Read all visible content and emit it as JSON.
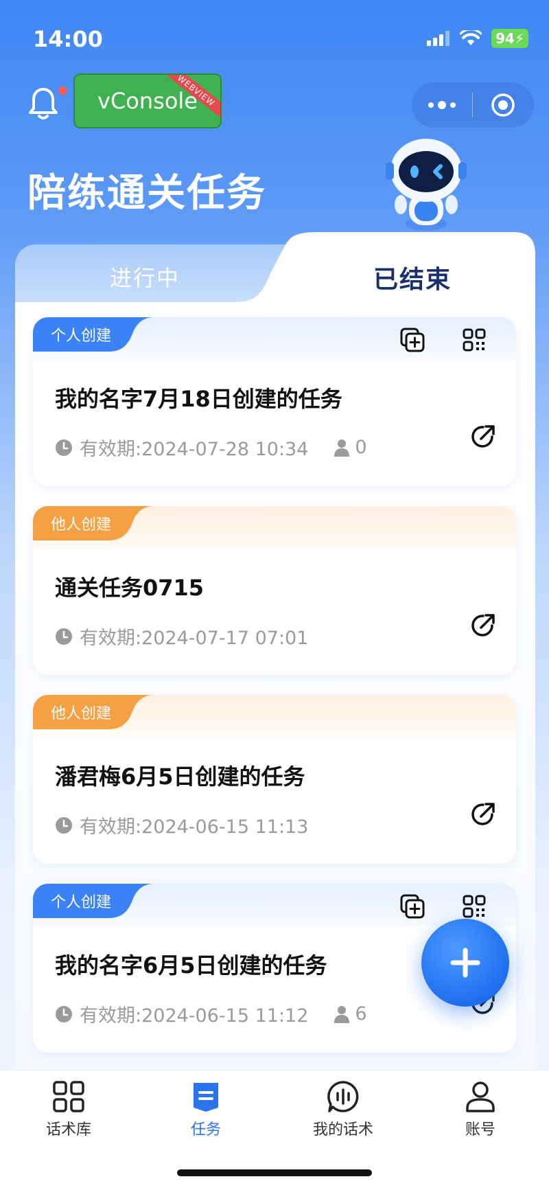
{
  "status_bar": {
    "time": "14:00",
    "battery": "94"
  },
  "header": {
    "vconsole_label": "vConsole",
    "webview_badge": "WEBVIEW",
    "page_title": "陪练通关任务"
  },
  "tabs": [
    {
      "label": "进行中",
      "selected": false
    },
    {
      "label": "已结束",
      "selected": true
    }
  ],
  "cards": [
    {
      "tag": "个人创建",
      "tag_type": "own",
      "title": "我的名字7月18日创建的任务",
      "validity": "有效期:2024-07-28 10:34",
      "participants": "0"
    },
    {
      "tag": "他人创建",
      "tag_type": "other",
      "title": "通关任务0715",
      "validity": "有效期:2024-07-17 07:01"
    },
    {
      "tag": "他人创建",
      "tag_type": "other",
      "title": "潘君梅6月5日创建的任务",
      "validity": "有效期:2024-06-15 11:13"
    },
    {
      "tag": "个人创建",
      "tag_type": "own",
      "title": "我的名字6月5日创建的任务",
      "validity": "有效期:2024-06-15 11:12",
      "participants": "6"
    }
  ],
  "tabbar": [
    {
      "label": "话术库",
      "icon": "grid-icon",
      "active": false
    },
    {
      "label": "任务",
      "icon": "task-icon",
      "active": true
    },
    {
      "label": "我的话术",
      "icon": "voice-bubble-icon",
      "active": false
    },
    {
      "label": "账号",
      "icon": "user-icon",
      "active": false
    }
  ],
  "colors": {
    "primary": "#2a74f2",
    "own_tag": "#3b82f6",
    "other_tag": "#f5a042",
    "title_dark": "#1a2f6b"
  }
}
